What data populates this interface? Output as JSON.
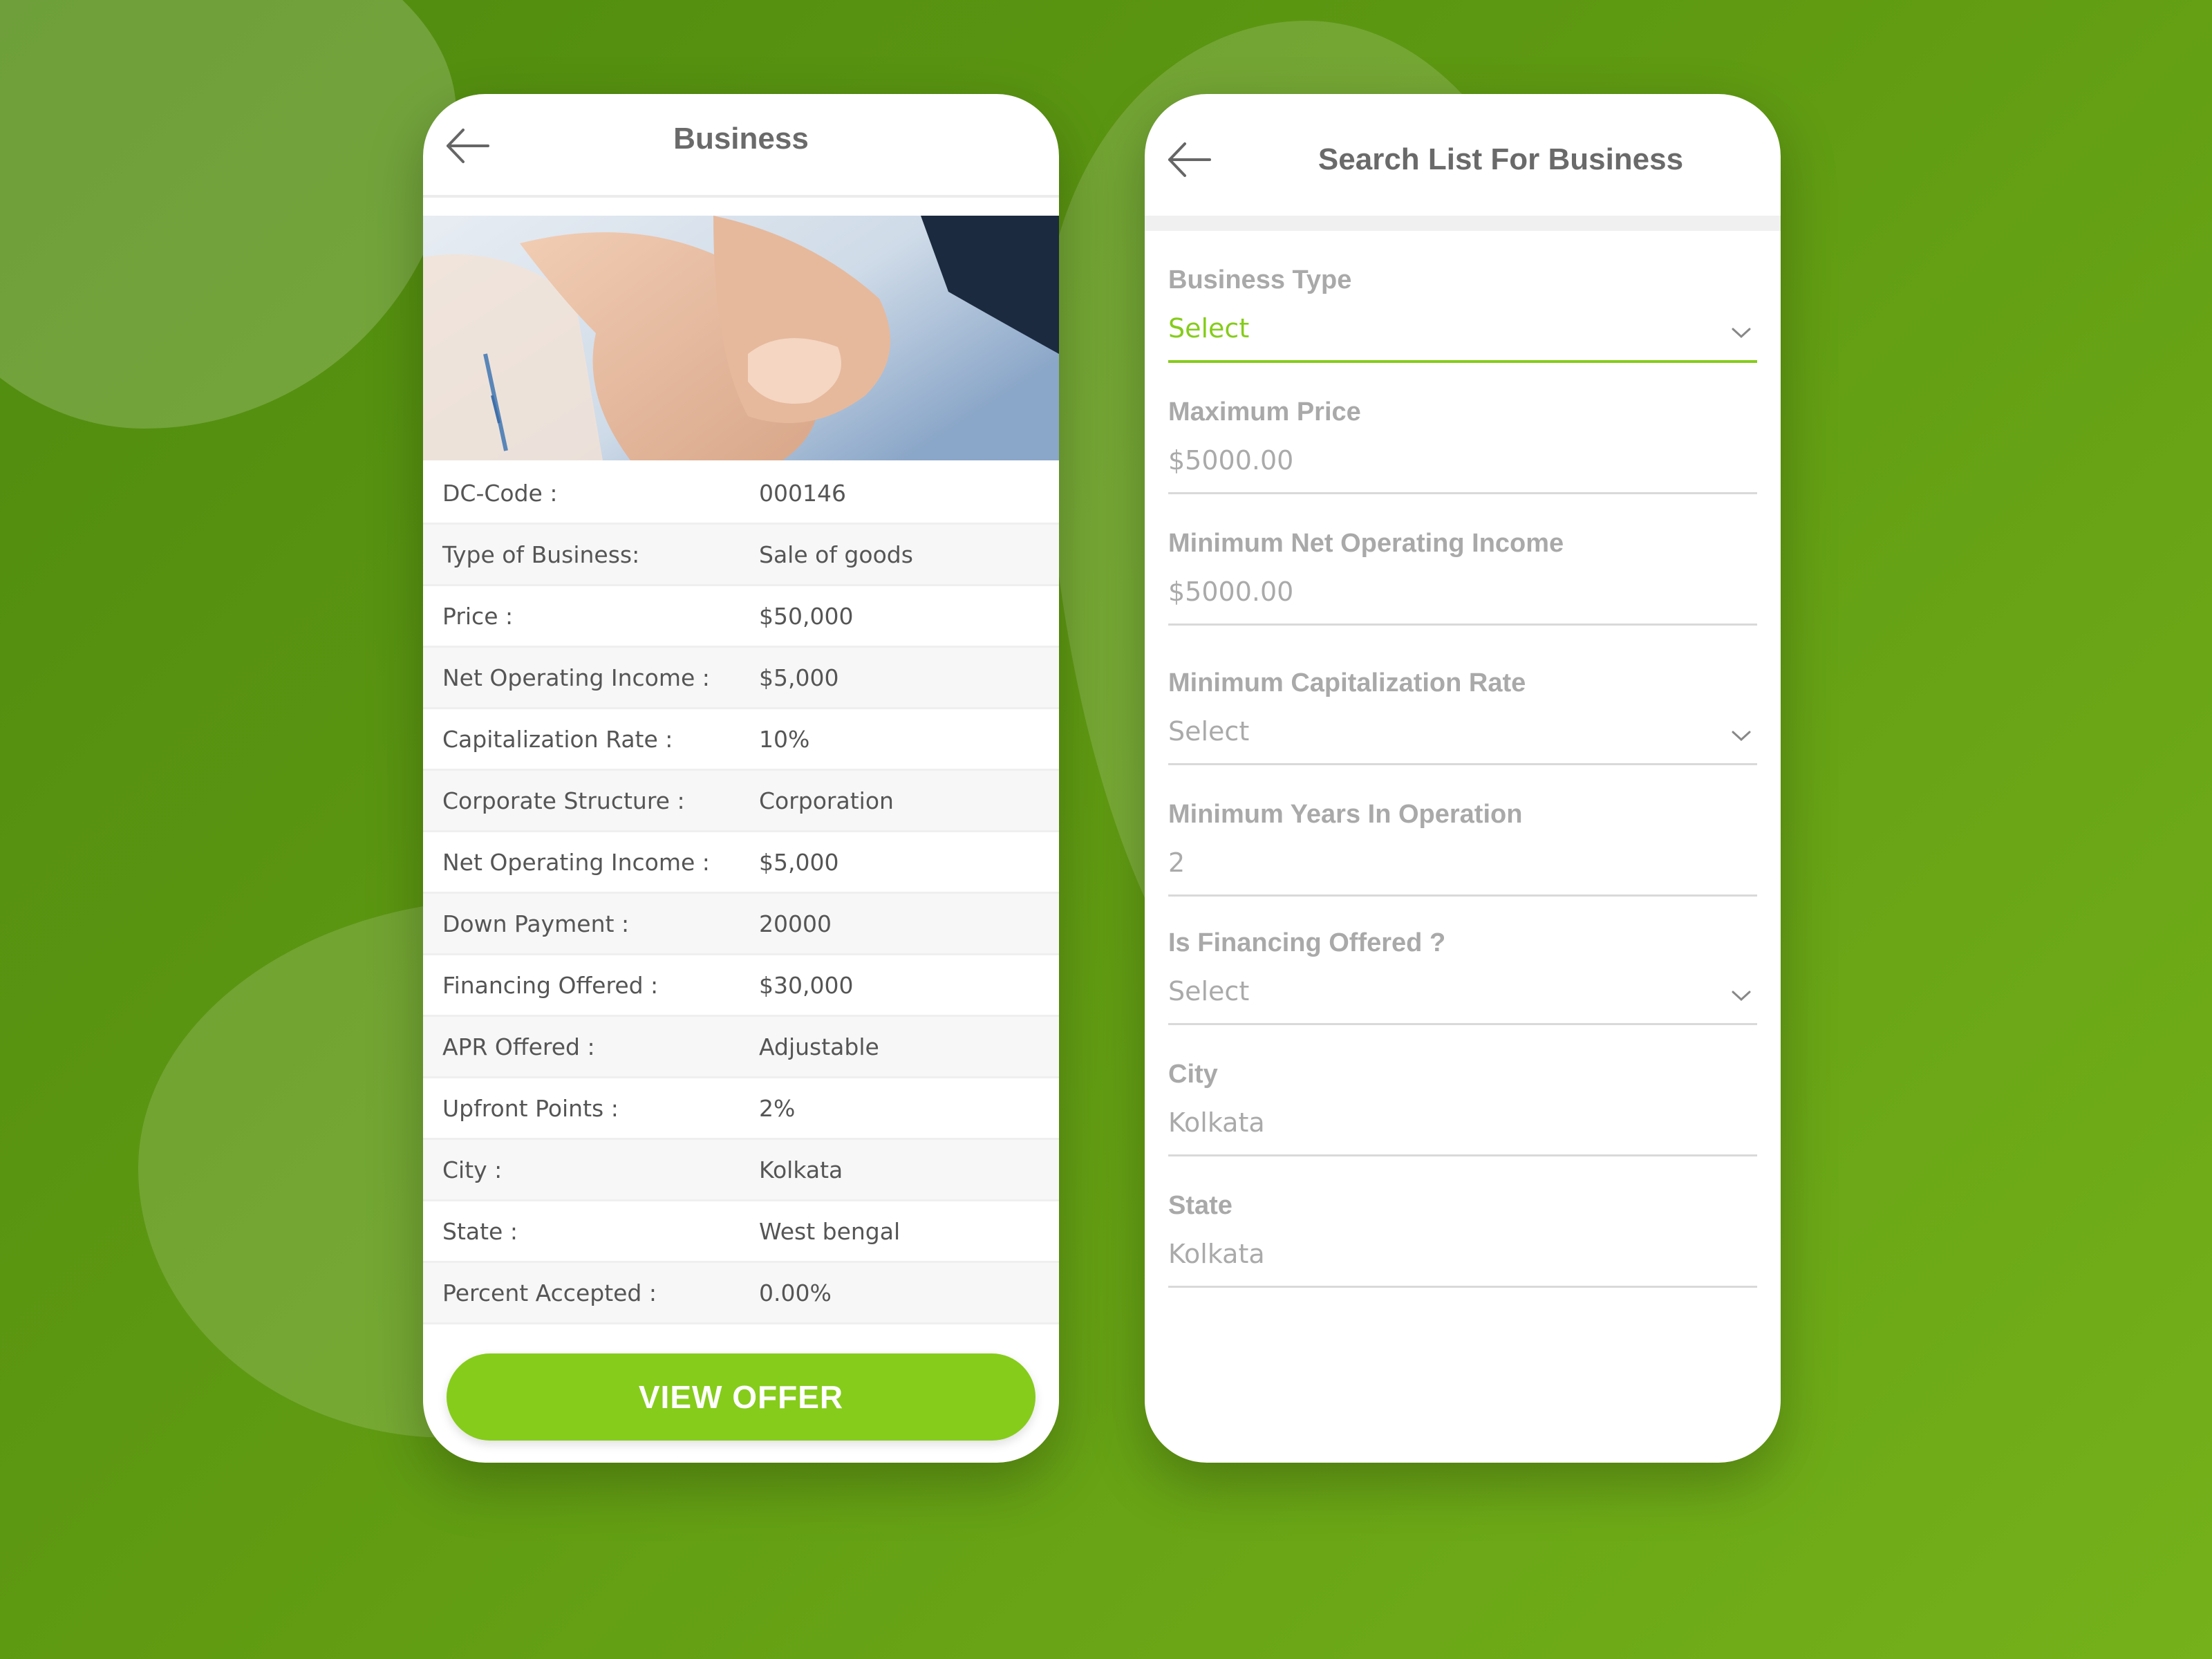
{
  "theme": {
    "accent": "#86cc1b",
    "background": "#5f9a12",
    "text_muted": "#a9a9a9"
  },
  "business_screen": {
    "title": "Business",
    "back_icon": "arrow-left-icon",
    "hero_image": "handshake-photo",
    "details": [
      {
        "label": "DC-Code :",
        "value": "000146"
      },
      {
        "label": "Type of Business:",
        "value": "Sale of goods"
      },
      {
        "label": "Price :",
        "value": "$50,000"
      },
      {
        "label": "Net Operating Income :",
        "value": "$5,000"
      },
      {
        "label": "Capitalization Rate :",
        "value": "10%"
      },
      {
        "label": "Corporate Structure :",
        "value": "Corporation"
      },
      {
        "label": "Net Operating Income :",
        "value": "$5,000"
      },
      {
        "label": "Down Payment :",
        "value": "20000"
      },
      {
        "label": "Financing Offered :",
        "value": "$30,000"
      },
      {
        "label": "APR Offered :",
        "value": "Adjustable"
      },
      {
        "label": "Upfront Points :",
        "value": "2%"
      },
      {
        "label": "City :",
        "value": "Kolkata"
      },
      {
        "label": "State :",
        "value": "West bengal"
      },
      {
        "label": "Percent Accepted :",
        "value": "0.00%"
      }
    ],
    "view_offer_label": "VIEW OFFER"
  },
  "search_screen": {
    "title": "Search List For Business",
    "back_icon": "arrow-left-icon",
    "fields": [
      {
        "label": "Business Type",
        "value": "Select",
        "dropdown": true
      },
      {
        "label": "Maximum Price",
        "value": "$5000.00",
        "dropdown": false
      },
      {
        "label": "Minimum Net Operating Income",
        "value": "$5000.00",
        "dropdown": false
      },
      {
        "label": "Minimum Capitalization Rate",
        "value": "Select",
        "dropdown": true
      },
      {
        "label": "Minimum Years In Operation",
        "value": "2",
        "dropdown": false
      },
      {
        "label": "Is Financing Offered ?",
        "value": "Select",
        "dropdown": true
      },
      {
        "label": "City",
        "value": "Kolkata",
        "dropdown": false
      },
      {
        "label": "State",
        "value": "Kolkata",
        "dropdown": false
      }
    ]
  }
}
